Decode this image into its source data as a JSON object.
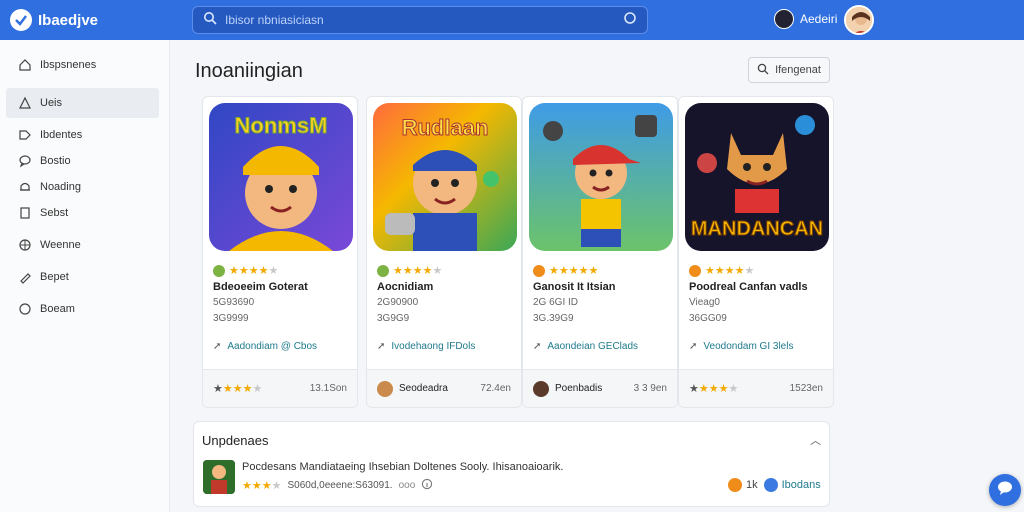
{
  "topbar": {
    "app_name": "Ibaedjve",
    "search_placeholder": "Ibisor nbniasiciasn",
    "user_name": "Aedeiri"
  },
  "sidebar": {
    "items": [
      {
        "label": "Ibspsnenes",
        "icon": "home-icon"
      },
      {
        "label": "Ueis",
        "icon": "star-icon",
        "active": true
      },
      {
        "label": "Ibdentes",
        "icon": "tag-icon"
      },
      {
        "label": "Bostio",
        "icon": "chat-icon"
      },
      {
        "label": "Noading",
        "icon": "bell-icon"
      },
      {
        "label": "Sebst",
        "icon": "doc-icon"
      },
      {
        "label": "Weenne",
        "icon": "globe-icon"
      },
      {
        "label": "Bepet",
        "icon": "pen-icon"
      },
      {
        "label": "Boeam",
        "icon": "circle-icon"
      }
    ]
  },
  "main": {
    "title": "Inoaniingian",
    "filter_label": "Ifengenat"
  },
  "cards": [
    {
      "art_text": "NonmsM",
      "rating": 3.5,
      "title": "Bdeoeeim Goterat",
      "line1": "5G93690",
      "line2": "3G9999",
      "link": "Aadondiam @ Cbos",
      "footer_label": "",
      "footer_value": "13.1Son",
      "colors": {
        "bg": "#3b5bd0",
        "accent": "#f5b800",
        "badge": "#7cb342"
      }
    },
    {
      "art_text": "Rudlaan",
      "rating": 4,
      "title": "Aocnidiam",
      "line1": "2G90900",
      "line2": "3G9G9",
      "link": "Ivodehaong IFDols",
      "footer_label": "Seodeadra",
      "footer_value": "72.4en",
      "colors": {
        "bg": "#2e9c4d",
        "accent": "#f5b800",
        "badge": "#7cb342"
      }
    },
    {
      "art_text": "",
      "rating": 5,
      "title": "Ganosit It Itsian",
      "line1": "2G 6GI ID",
      "line2": "3G.39G9",
      "link": "Aaondeian GEClads",
      "footer_label": "Poenbadis",
      "footer_value": "3 3 9en",
      "colors": {
        "bg": "#41a6e8",
        "accent": "#f5b800",
        "badge": "#f08c1a"
      }
    },
    {
      "art_text": "MANDANCAN",
      "rating": 4,
      "title": "Poodreal Canfan vadls",
      "line1": "Vieag0",
      "line2": "36GG09",
      "link": "Veodondam GI 3lels",
      "footer_label": "",
      "footer_value": "1523en",
      "colors": {
        "bg": "#1a1a2e",
        "accent": "#f5b800",
        "badge": "#f08c1a"
      }
    }
  ],
  "updates": {
    "title": "Unpdenaes",
    "item_text": "Pocdesans Mandiataeing Ihsebian Doltenes Sooly. Ihisanoaioarik.",
    "item_meta": "S060d,0eeene:S63091.",
    "item_meta_tag": "ooo",
    "right_count": "1k",
    "right_label": "Ibodans",
    "rating": 3.5
  }
}
